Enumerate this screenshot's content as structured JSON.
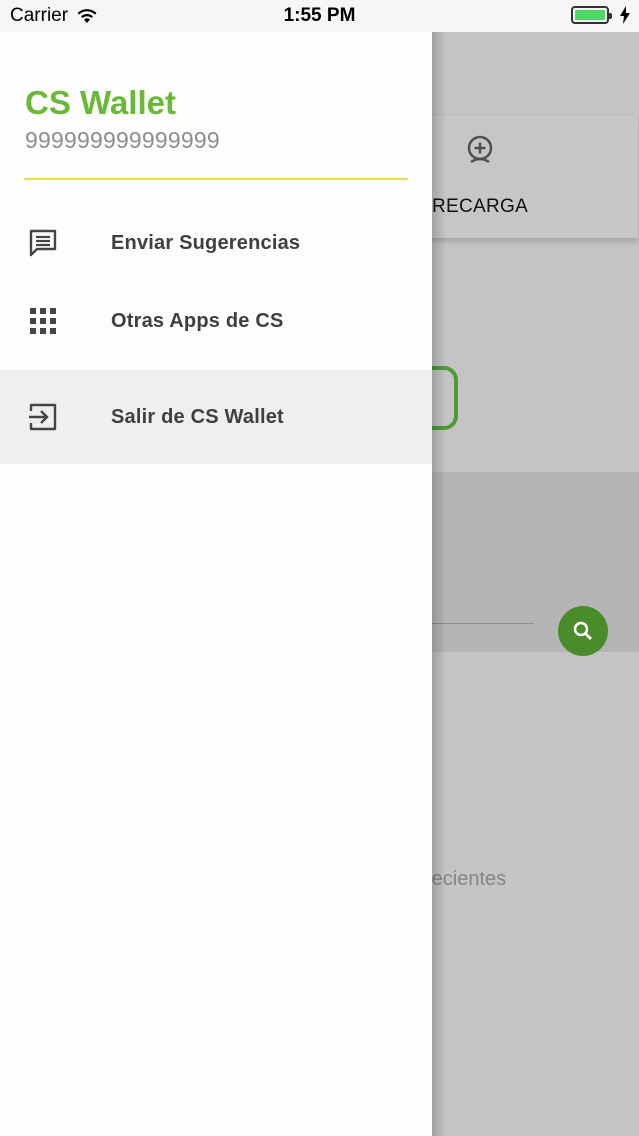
{
  "status_bar": {
    "carrier": "Carrier",
    "time": "1:55 PM",
    "icons": [
      "wifi-icon",
      "battery-icon",
      "charging-bolt-icon"
    ]
  },
  "drawer": {
    "title": "CS Wallet",
    "account_number": "999999999999999",
    "menu": [
      {
        "label": "Enviar Sugerencias",
        "icon": "feedback-icon"
      },
      {
        "label": "Otras Apps de CS",
        "icon": "apps-grid-icon"
      },
      {
        "label": "Salir de CS Wallet",
        "icon": "logout-icon",
        "selected": true
      }
    ]
  },
  "background": {
    "recarga_label": "RECARGA",
    "recientes_text": "recientes",
    "icons": [
      "add-money-icon",
      "search-icon"
    ]
  },
  "colors": {
    "brand_green": "#6ab837",
    "divider_yellow": "#ece04e",
    "search_button": "#4a8c2a"
  }
}
